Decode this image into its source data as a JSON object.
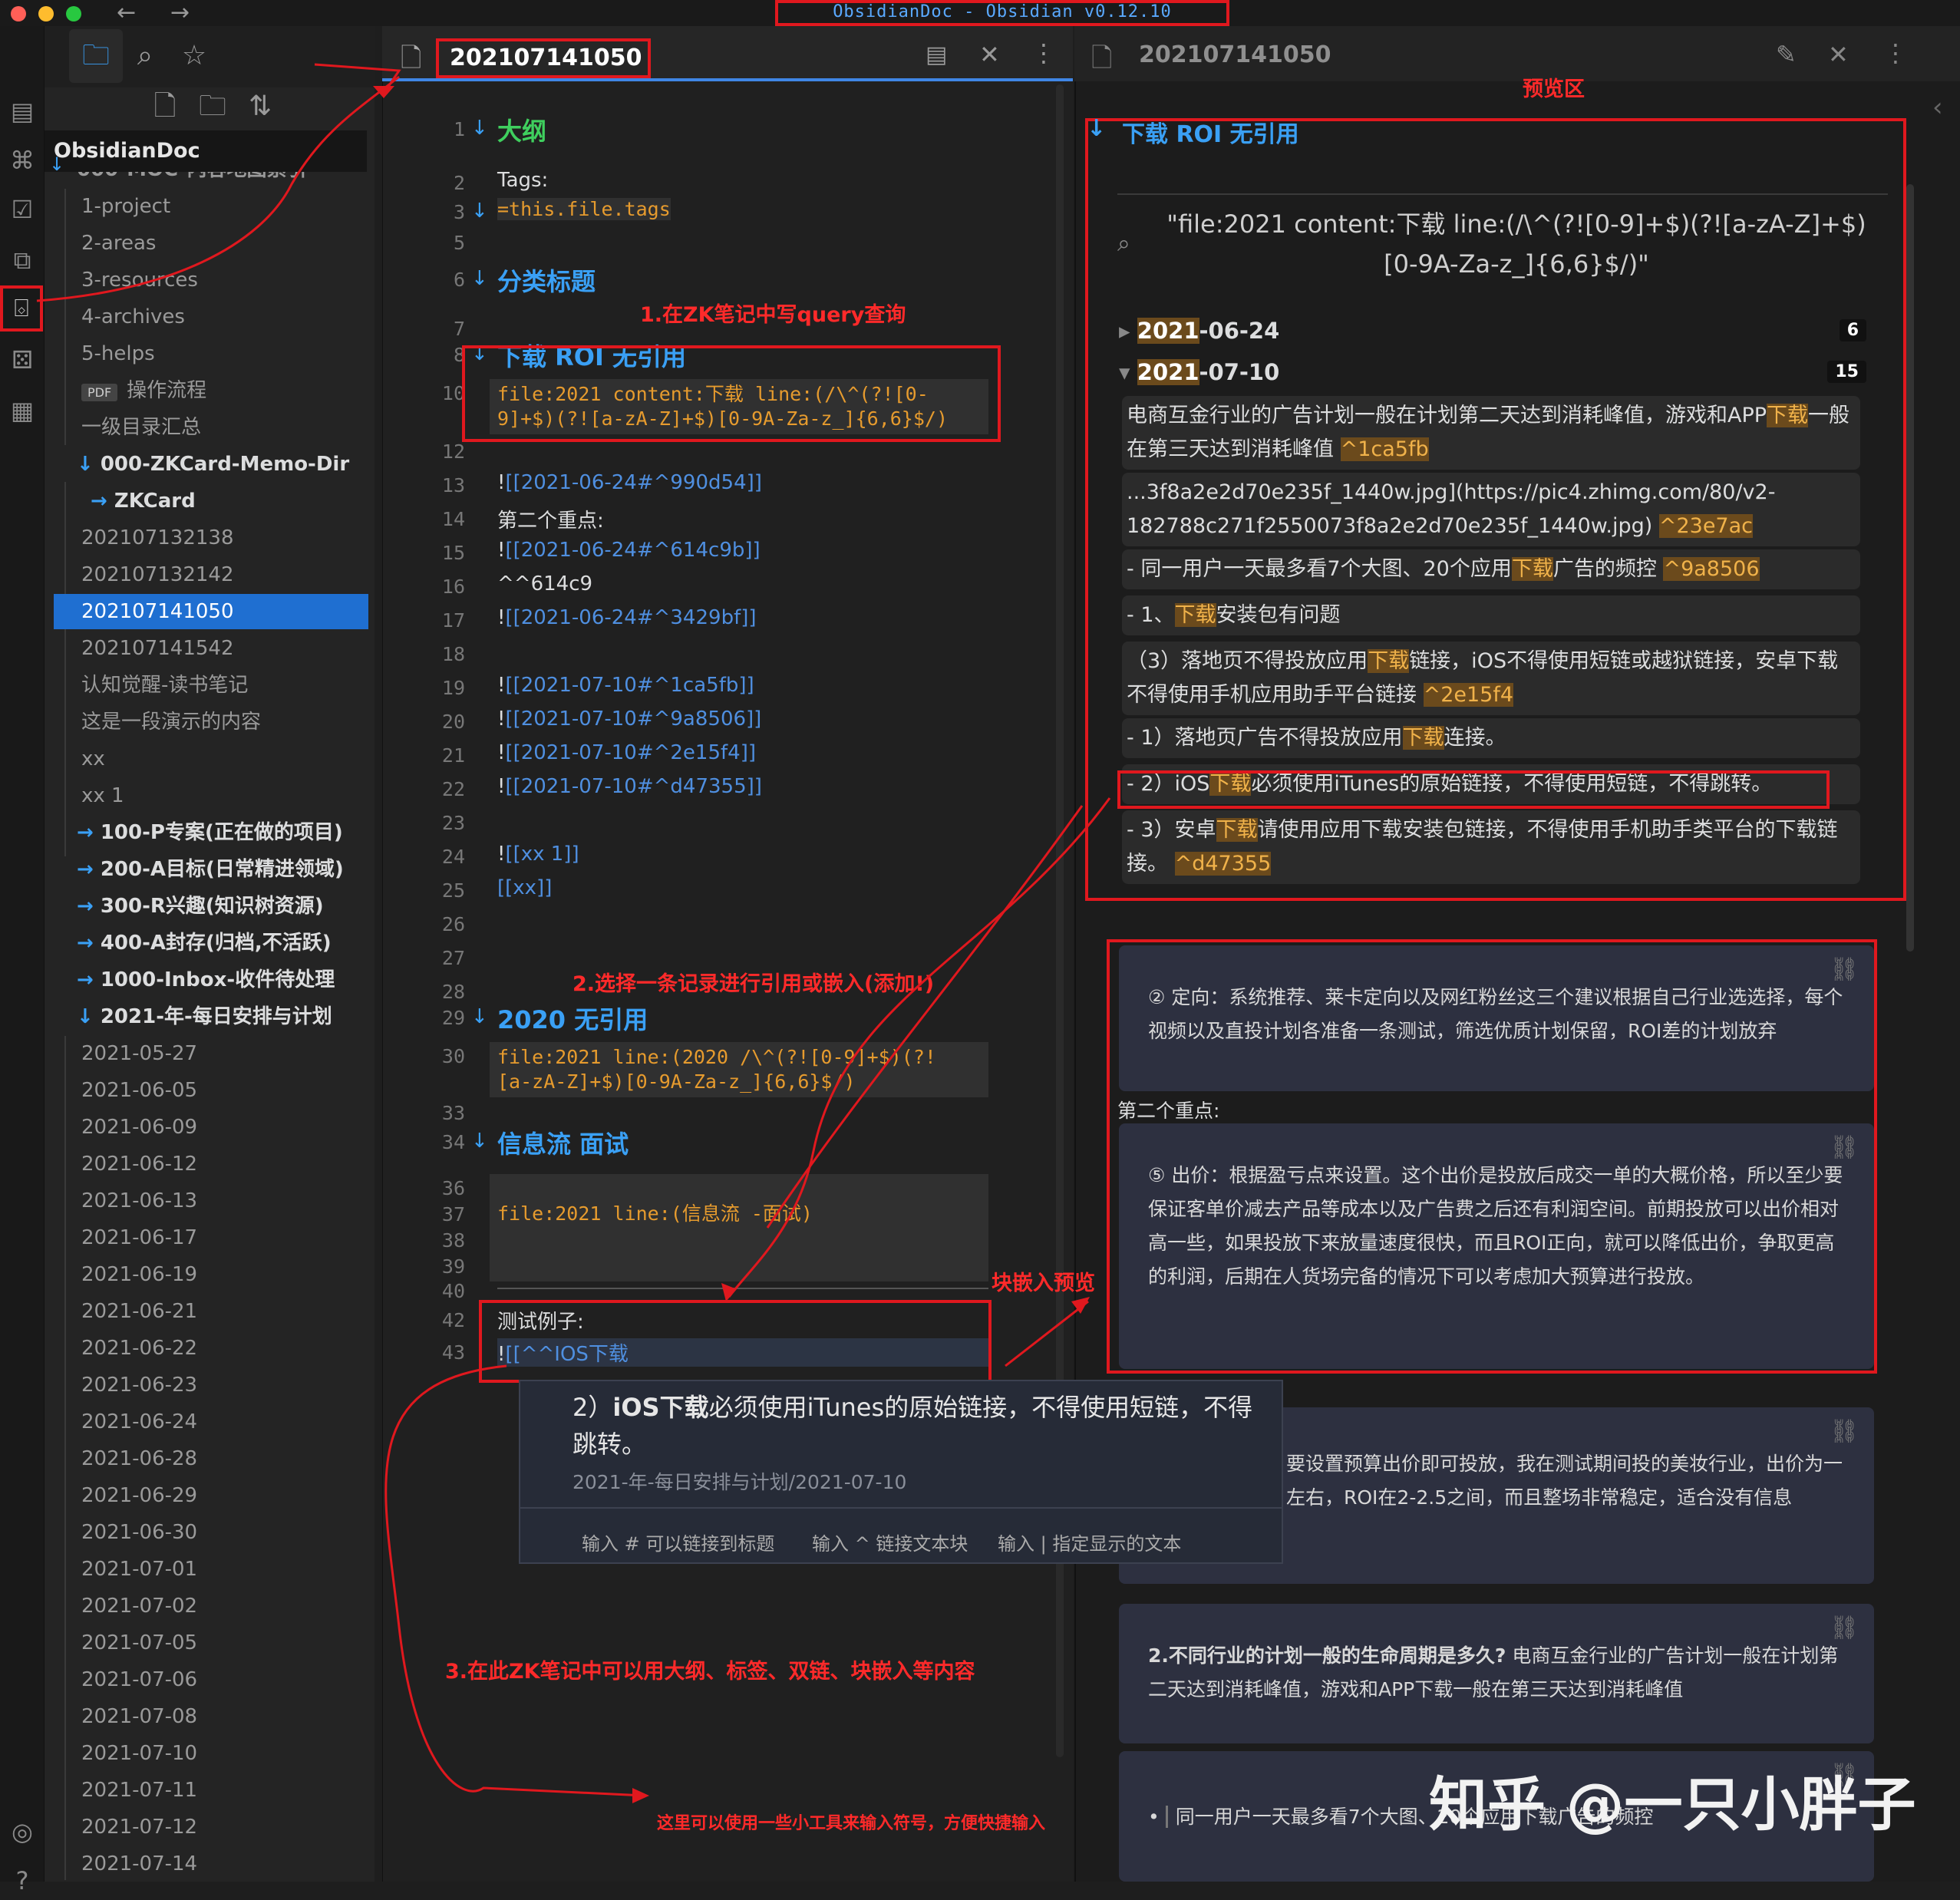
{
  "window": {
    "title": "ObsidianDoc - Obsidian v0.12.10"
  },
  "colors": {
    "accent": "#1f6fd1",
    "annotation": "#e0181e",
    "link": "#4f8fe0",
    "code": "#e69b2e",
    "heading": "#3aa0f5"
  },
  "nav": {
    "back_icon": "←",
    "forward_icon": "→"
  },
  "sidebar": {
    "vault_name": "ObsidianDoc",
    "clipped_folder": "000-MOC-内容地图索引",
    "items": [
      {
        "label": "1-project",
        "kind": "file"
      },
      {
        "label": "2-areas",
        "kind": "file"
      },
      {
        "label": "3-resources",
        "kind": "file"
      },
      {
        "label": "4-archives",
        "kind": "file"
      },
      {
        "label": "5-helps",
        "kind": "file"
      },
      {
        "label": "操作流程",
        "kind": "pdf",
        "badge": "PDF"
      },
      {
        "label": "一级目录汇总",
        "kind": "file"
      },
      {
        "label": "000-ZKCard-Memo-Dir",
        "kind": "folder-open"
      },
      {
        "label": "ZKCard",
        "kind": "folder-closed"
      },
      {
        "label": "202107132138",
        "kind": "file"
      },
      {
        "label": "202107132142",
        "kind": "file"
      },
      {
        "label": "202107141050",
        "kind": "file-active"
      },
      {
        "label": "202107141542",
        "kind": "file"
      },
      {
        "label": "认知觉醒-读书笔记",
        "kind": "file"
      },
      {
        "label": "这是一段演示的内容",
        "kind": "file"
      },
      {
        "label": "xx",
        "kind": "file"
      },
      {
        "label": "xx 1",
        "kind": "file"
      },
      {
        "label": "100-P专案(正在做的项目)",
        "kind": "folder-closed"
      },
      {
        "label": "200-A目标(日常精进领域)",
        "kind": "folder-closed"
      },
      {
        "label": "300-R兴趣(知识树资源)",
        "kind": "folder-closed"
      },
      {
        "label": "400-A封存(归档,不活跃)",
        "kind": "folder-closed"
      },
      {
        "label": "1000-Inbox-收件待处理",
        "kind": "folder-closed"
      },
      {
        "label": "2021-年-每日安排与计划",
        "kind": "folder-open"
      },
      {
        "label": "2021-05-27",
        "kind": "file"
      },
      {
        "label": "2021-06-05",
        "kind": "file"
      },
      {
        "label": "2021-06-09",
        "kind": "file"
      },
      {
        "label": "2021-06-12",
        "kind": "file"
      },
      {
        "label": "2021-06-13",
        "kind": "file"
      },
      {
        "label": "2021-06-17",
        "kind": "file"
      },
      {
        "label": "2021-06-19",
        "kind": "file"
      },
      {
        "label": "2021-06-21",
        "kind": "file"
      },
      {
        "label": "2021-06-22",
        "kind": "file"
      },
      {
        "label": "2021-06-23",
        "kind": "file"
      },
      {
        "label": "2021-06-24",
        "kind": "file"
      },
      {
        "label": "2021-06-28",
        "kind": "file"
      },
      {
        "label": "2021-06-29",
        "kind": "file"
      },
      {
        "label": "2021-06-30",
        "kind": "file"
      },
      {
        "label": "2021-07-01",
        "kind": "file"
      },
      {
        "label": "2021-07-02",
        "kind": "file"
      },
      {
        "label": "2021-07-05",
        "kind": "file"
      },
      {
        "label": "2021-07-06",
        "kind": "file"
      },
      {
        "label": "2021-07-08",
        "kind": "file"
      },
      {
        "label": "2021-07-10",
        "kind": "file"
      },
      {
        "label": "2021-07-11",
        "kind": "file"
      },
      {
        "label": "2021-07-12",
        "kind": "file"
      },
      {
        "label": "2021-07-14",
        "kind": "file"
      }
    ]
  },
  "editor": {
    "tab_title": "202107141050",
    "lines": [
      {
        "n": "1",
        "type": "heading-green",
        "text": "大纲",
        "fold": true
      },
      {
        "n": "2",
        "type": "text",
        "text": "Tags:"
      },
      {
        "n": "3",
        "type": "code-inline",
        "text": "=this.file.tags",
        "fold": true
      },
      {
        "n": "5",
        "type": "empty",
        "text": ""
      },
      {
        "n": "6",
        "type": "heading",
        "text": "分类标题",
        "fold": true
      },
      {
        "n": "7",
        "type": "empty",
        "text": ""
      },
      {
        "n": "8",
        "type": "heading",
        "text": "下载 ROI 无引用",
        "fold": true
      },
      {
        "n": "10",
        "type": "code",
        "text": "file:2021 content:下载 line:(/\\^(?![0-",
        "text2": "9]+$)(?![a-zA-Z]+$)[0-9A-Za-z_]{6,6}$/)"
      },
      {
        "n": "12",
        "type": "empty",
        "text": ""
      },
      {
        "n": "13",
        "type": "embed",
        "prefix": "!",
        "text": "[[2021-06-24#^990d54]]"
      },
      {
        "n": "14",
        "type": "text",
        "text": "第二个重点:"
      },
      {
        "n": "15",
        "type": "embed",
        "prefix": "!",
        "text": "[[2021-06-24#^614c9b]]"
      },
      {
        "n": "16",
        "type": "text",
        "text": "^^614c9"
      },
      {
        "n": "17",
        "type": "embed",
        "prefix": "!",
        "text": "[[2021-06-24#^3429bf]]"
      },
      {
        "n": "18",
        "type": "empty",
        "text": ""
      },
      {
        "n": "19",
        "type": "embed",
        "prefix": "!",
        "text": "[[2021-07-10#^1ca5fb]]"
      },
      {
        "n": "20",
        "type": "embed",
        "prefix": "!",
        "text": "[[2021-07-10#^9a8506]]"
      },
      {
        "n": "21",
        "type": "embed",
        "prefix": "!",
        "text": "[[2021-07-10#^2e15f4]]"
      },
      {
        "n": "22",
        "type": "embed",
        "prefix": "!",
        "text": "[[2021-07-10#^d47355]]"
      },
      {
        "n": "23",
        "type": "empty",
        "text": ""
      },
      {
        "n": "24",
        "type": "embed",
        "prefix": "!",
        "text": "[[xx 1]]"
      },
      {
        "n": "25",
        "type": "embed",
        "prefix": "",
        "text": "[[xx]]"
      },
      {
        "n": "26",
        "type": "empty",
        "text": ""
      },
      {
        "n": "27",
        "type": "empty",
        "text": ""
      },
      {
        "n": "28",
        "type": "empty",
        "text": ""
      },
      {
        "n": "29",
        "type": "heading",
        "text": "2020 无引用",
        "fold": true
      },
      {
        "n": "30",
        "type": "code",
        "text": "file:2021 line:(2020 /\\^(?![0-9]+$)(?!",
        "text2": "[a-zA-Z]+$)[0-9A-Za-z_]{6,6}$/)"
      },
      {
        "n": "33",
        "type": "empty",
        "text": ""
      },
      {
        "n": "34",
        "type": "heading",
        "text": "信息流 面试",
        "fold": true
      },
      {
        "n": "36",
        "type": "codeblock-start",
        "text": ""
      },
      {
        "n": "37",
        "type": "code",
        "text": "file:2021 line:(信息流 -面试)"
      },
      {
        "n": "38",
        "type": "empty",
        "text": ""
      },
      {
        "n": "39",
        "type": "empty",
        "text": ""
      },
      {
        "n": "40",
        "type": "rule",
        "text": ""
      },
      {
        "n": "42",
        "type": "text",
        "text": "测试例子:"
      },
      {
        "n": "43",
        "type": "embed",
        "prefix": "!",
        "text": "[[^^IOS下载"
      }
    ]
  },
  "popup": {
    "num": "2）",
    "bold": "iOS下载",
    "rest": "必须使用iTunes的原始链接，不得使用短链，不得跳转。",
    "path": "2021-年-每日安排与计划/2021-07-10",
    "hints": [
      "输入 # 可以链接到标题",
      "输入 ^ 链接文本块",
      "输入 | 指定显示的文本"
    ]
  },
  "preview": {
    "tab_title": "202107141050",
    "area_label": "预览区",
    "heading": "下载 ROI 无引用",
    "query": "\"file:2021 content:下载 line:(/\\^(?![0-9]+$)(?![a-zA-Z]+$)",
    "query2": "[0-9A-Za-z_]{6,6}$/)\"",
    "groups": [
      {
        "date_bold": "2021",
        "date_rest": "-06-24",
        "count": "6",
        "collapsed": true
      },
      {
        "date_bold": "2021",
        "date_rest": "-07-10",
        "count": "15",
        "collapsed": false
      }
    ],
    "results": [
      {
        "pre": "电商互金行业的广告计划一般在计划第二天达到消耗峰值，游戏和APP",
        "hl": "下载",
        "post": "一般在第三天达到消耗峰值 ",
        "id": "^1ca5fb"
      },
      {
        "pre": "...3f8a2e2d70e235f_1440w.jpg](https://pic4.zhimg.com/80/v2-182788c271f2550073f8a2e2d70e235f_1440w.jpg) ",
        "hl": "",
        "post": "",
        "id": "^23e7ac"
      },
      {
        "pre": "- 同一用户一天最多看7个大图、20个应用",
        "hl": "下载",
        "post": "广告的频控 ",
        "id": "^9a8506"
      },
      {
        "pre": "- 1、",
        "hl": "下载",
        "post": "安装包有问题",
        "id": ""
      },
      {
        "pre": "（3）落地页不得投放应用",
        "hl": "下载",
        "post": "链接，iOS不得使用短链或越狱链接，安卓下载不得使用手机应用助手平台链接 ",
        "id": "^2e15f4"
      },
      {
        "pre": "- 1）落地页广告不得投放应用",
        "hl": "下载",
        "post": "连接。",
        "id": ""
      },
      {
        "pre": "- 2）iOS",
        "hl": "下载",
        "post": "必须使用iTunes的原始链接，不得使用短链，不得跳转。",
        "id": ""
      },
      {
        "pre": "- 3）安卓",
        "hl": "下载",
        "post": "请使用应用下载安装包链接，不得使用手机助手类平台的下载链接。 ",
        "id": "^d47355"
      }
    ],
    "embed1": "② 定向：系统推荐、莱卡定向以及网红粉丝这三个建议根据自己行业选选择，每个视频以及直投计划各准备一条测试，筛选优质计划保留，ROI差的计划放弃",
    "between_label": "第二个重点:",
    "embed2": "⑤ 出价：根据盈亏点来设置。这个出价是投放后成交一单的大概价格，所以至少要保证客单价减去产品等成本以及广告费之后还有利润空间。前期投放可以出价相对高一些，如果投放下来放量速度很快，而且ROI正向，就可以降低出价，争取更高的利润，后期在人货场完备的情况下可以考虑加大预算进行投放。",
    "embed3": "要设置预算出价即可投放，我在测试期间投的美妆行业，出价为一左右，ROI在2-2.5之间，而且整场非常稳定，适合没有信息",
    "embed4_bold": "2.不同行业的计划一般的生命周期是多久?",
    "embed4_rest": " 电商互金行业的广告计划一般在计划第二天达到消耗峰值，游戏和APP下载一般在第三天达到消耗峰值",
    "embed5": "同一用户一天最多看7个大图、20个应用下载广告的频控"
  },
  "annotations": {
    "a1": "1.在ZK笔记中写query查询",
    "a2": "2.选择一条记录进行引用或嵌入(添加!)",
    "a3": "块嵌入预览",
    "a4": "3.在此ZK笔记中可以用大纲、标签、双链、块嵌入等内容",
    "a5": "这里可以使用一些小工具来输入符号，方便快捷输入"
  },
  "watermark": "知乎 @一只小胖子"
}
